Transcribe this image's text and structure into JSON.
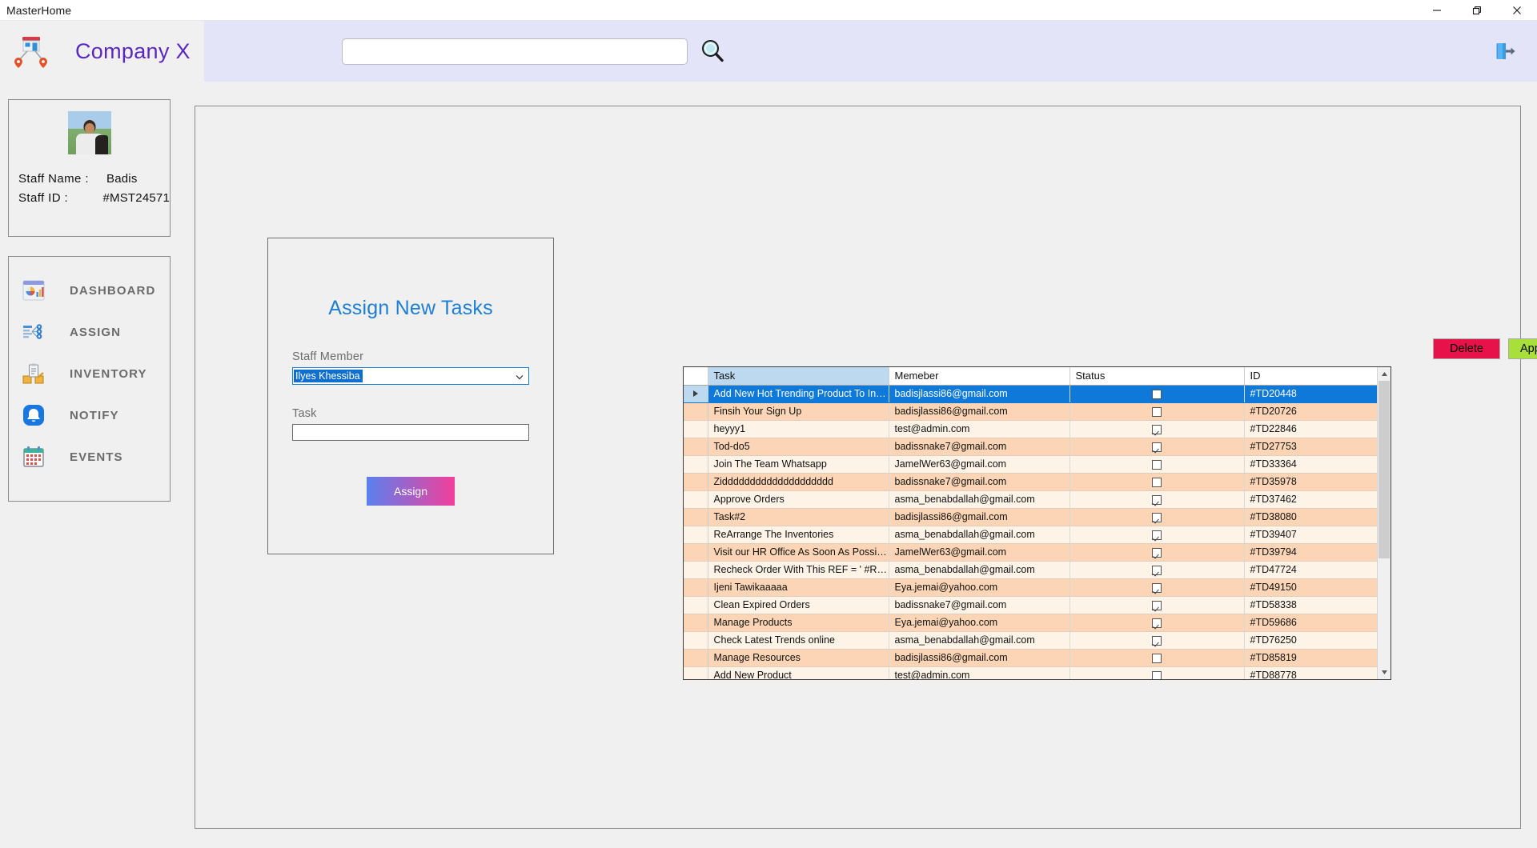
{
  "window": {
    "title": "MasterHome",
    "minimize_label": "minimize",
    "maximize_label": "maximize",
    "close_label": "close"
  },
  "header": {
    "brand": "Company X",
    "logo_icon": "shop-network-icon",
    "search_value": "",
    "search_placeholder": "",
    "search_icon": "search-icon",
    "logout_icon": "logout-icon"
  },
  "staff_card": {
    "avatar_icon": "user-photo",
    "name_label": "Staff  Name :",
    "name_value": "Badis",
    "id_label": "Staff ID :",
    "id_value": "#MST24571"
  },
  "sidebar": {
    "items": [
      {
        "label": "DASHBOARD",
        "icon": "dashboard-icon"
      },
      {
        "label": "ASSIGN",
        "icon": "assign-icon"
      },
      {
        "label": "INVENTORY",
        "icon": "inventory-icon"
      },
      {
        "label": "NOTIFY",
        "icon": "notify-bell-icon"
      },
      {
        "label": "EVENTS",
        "icon": "calendar-icon"
      }
    ]
  },
  "assign_form": {
    "title": "Assign New Tasks",
    "staff_label": "Staff Member",
    "staff_selected": "Ilyes Khessiba",
    "dropdown_icon": "chevron-down-icon",
    "task_label": "Task",
    "task_value": "",
    "submit_label": "Assign"
  },
  "actions": {
    "delete_label": "Delete",
    "delete_color": "#e8124a",
    "approve_label": "Approve",
    "approve_color": "#a8e039"
  },
  "grid": {
    "columns": [
      "",
      "Task",
      "Memeber",
      "Status",
      "ID"
    ],
    "selected_row_index": 0,
    "rows": [
      {
        "task": "Add New Hot Trending Product To Inve...",
        "member": "badisjlassi86@gmail.com",
        "status": false,
        "id": "#TD20448"
      },
      {
        "task": "Finsih Your Sign Up",
        "member": "badisjlassi86@gmail.com",
        "status": false,
        "id": "#TD20726"
      },
      {
        "task": "heyyy1",
        "member": "test@admin.com",
        "status": true,
        "id": "#TD22846"
      },
      {
        "task": "Tod-do5",
        "member": "badissnake7@gmail.com",
        "status": true,
        "id": "#TD27753"
      },
      {
        "task": "Join The Team Whatsapp",
        "member": "JamelWer63@gmail.com",
        "status": false,
        "id": "#TD33364"
      },
      {
        "task": "Zidddddddddddddddddddd",
        "member": "badissnake7@gmail.com",
        "status": false,
        "id": "#TD35978"
      },
      {
        "task": "Approve Orders",
        "member": "asma_benabdallah@gmail.com",
        "status": true,
        "id": "#TD37462"
      },
      {
        "task": "Task#2",
        "member": "badisjlassi86@gmail.com",
        "status": true,
        "id": "#TD38080"
      },
      {
        "task": "ReArrange The Inventories",
        "member": "asma_benabdallah@gmail.com",
        "status": true,
        "id": "#TD39407"
      },
      {
        "task": "Visit our HR Office As Soon As Possible",
        "member": "JamelWer63@gmail.com",
        "status": true,
        "id": "#TD39794"
      },
      {
        "task": "Recheck Order With This REF = ' #REF...",
        "member": "asma_benabdallah@gmail.com",
        "status": true,
        "id": "#TD47724"
      },
      {
        "task": "Ijeni Tawikaaaaa",
        "member": "Eya.jemai@yahoo.com",
        "status": true,
        "id": "#TD49150"
      },
      {
        "task": "Clean Expired Orders",
        "member": "badissnake7@gmail.com",
        "status": true,
        "id": "#TD58338"
      },
      {
        "task": "Manage Products",
        "member": "Eya.jemai@yahoo.com",
        "status": true,
        "id": "#TD59686"
      },
      {
        "task": "Check Latest Trends online",
        "member": "asma_benabdallah@gmail.com",
        "status": true,
        "id": "#TD76250"
      },
      {
        "task": "Manage Resources",
        "member": "badisjlassi86@gmail.com",
        "status": false,
        "id": "#TD85819"
      },
      {
        "task": "Add New Product",
        "member": "test@admin.com",
        "status": false,
        "id": "#TD88778"
      }
    ]
  }
}
